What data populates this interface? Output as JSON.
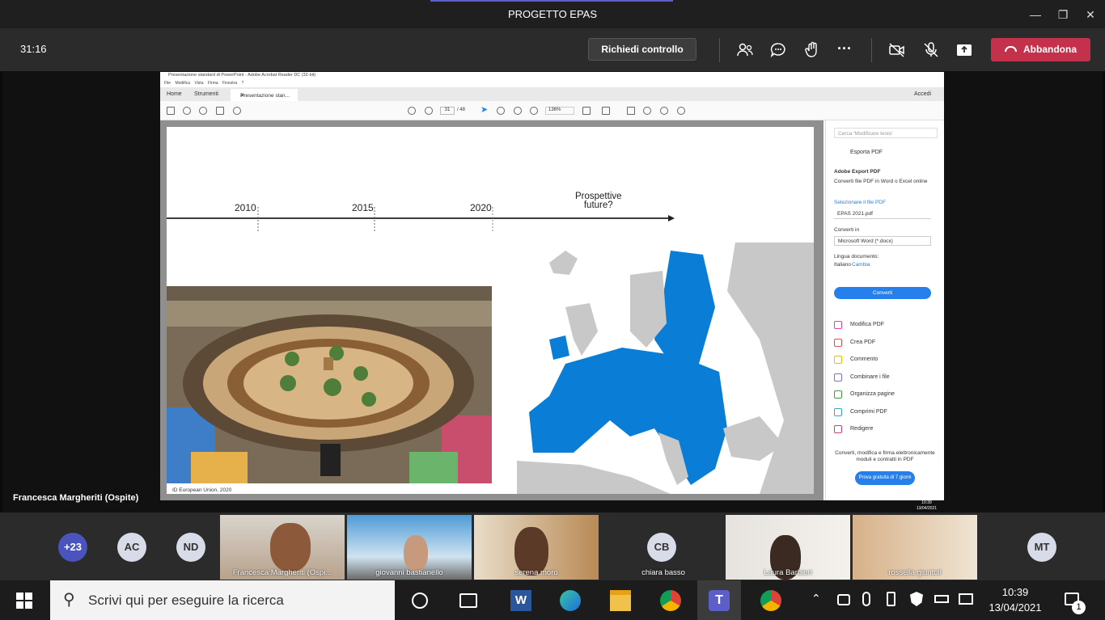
{
  "window": {
    "title": "PROGETTO EPAS"
  },
  "call": {
    "timer": "31:16",
    "request_control": "Richiedi controllo",
    "leave": "Abbandona"
  },
  "stage": {
    "speaker": "Francesca Margheriti (Ospite)"
  },
  "acrobat": {
    "title": "Presentazione standard di PowerPoint - Adobe Acrobat Reader DC (32-bit)",
    "menu": "File  Modifica  Vista  Firma  Finestra  ?",
    "tabs": [
      "Home",
      "Strumenti",
      "Presentazione stan..."
    ],
    "signin": "Accedi",
    "page_current": "31",
    "page_total": "/ 48",
    "zoom": "136%",
    "slide": {
      "years": [
        "2010",
        "2015",
        "2020"
      ],
      "future": "Prospettive\nfuture?",
      "caption": "ID European Union, 2020"
    },
    "panel": {
      "search_placeholder": "Cerca 'Modificare testo'",
      "export_header": "Esporta PDF",
      "export_title": "Adobe Export PDF",
      "export_desc": "Converti file PDF in Word o Excel online",
      "select_file": "Selezionare il file PDF",
      "file_name": "EPAS 2021.pdf",
      "convert_to": "Converti in",
      "format": "Microsoft Word (*.docx)",
      "lang_label": "Lingua documento:",
      "lang_value": "Italiano",
      "lang_change": "Cambia",
      "convert_btn": "Converti",
      "tools": [
        "Modifica PDF",
        "Crea PDF",
        "Commento",
        "Combinare i file",
        "Organizza pagine",
        "Comprimi PDF",
        "Redigere"
      ],
      "tool_colors": [
        "#e3419b",
        "#e34850",
        "#f5b800",
        "#7e6bd6",
        "#3a9b3a",
        "#2fa8c4",
        "#d13b7a"
      ],
      "promo": "Converti, modifica e firma elettronicamente moduli e contratti in PDF",
      "trial": "Prova gratuita di 7 giorni"
    },
    "taskbar_time": "10:39",
    "taskbar_date": "13/04/2021"
  },
  "gallery": {
    "avatars": [
      {
        "label": "+23"
      },
      {
        "label": "AC"
      },
      {
        "label": "ND"
      }
    ],
    "tiles": [
      {
        "name": "Francesca Margheriti (Ospi..."
      },
      {
        "name": "giovanni bastianello"
      },
      {
        "name": "serena moro"
      },
      {
        "name": "chiara basso",
        "initials": "CB"
      },
      {
        "name": "Laura Barbieri"
      },
      {
        "name": "rossella giuntoli"
      }
    ],
    "last_avatar": "MT"
  },
  "taskbar": {
    "search_placeholder": "Scrivi qui per eseguire la ricerca",
    "time": "10:39",
    "date": "13/04/2021",
    "notifications": "1"
  }
}
